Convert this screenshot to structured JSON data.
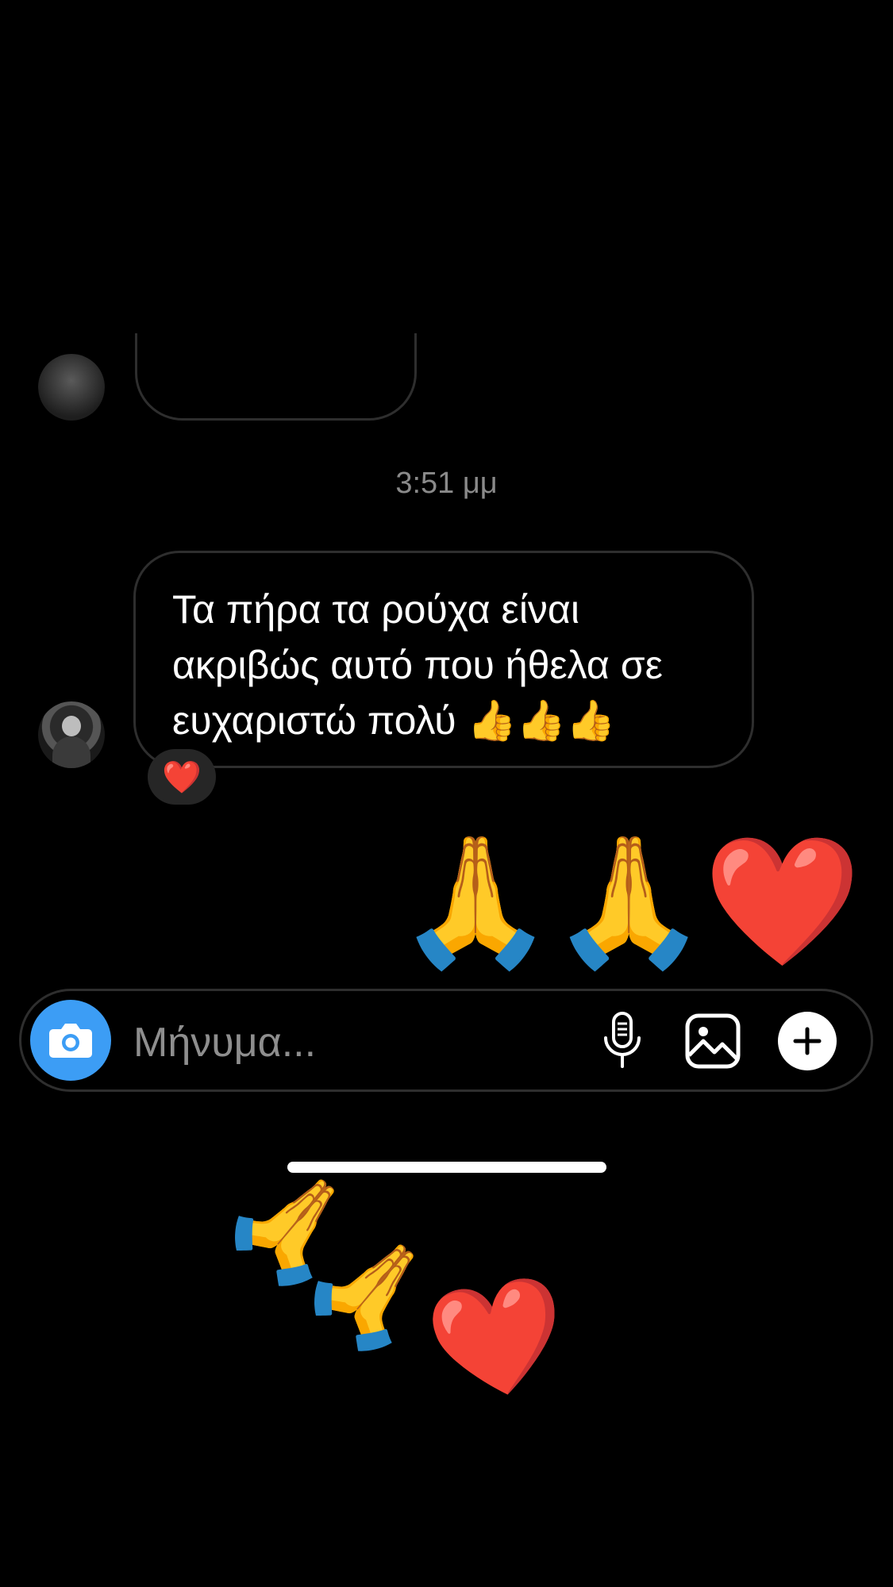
{
  "conversation": {
    "timestamp": "3:51 μμ",
    "incoming_message": {
      "text": "Τα πήρα τα ρούχα είναι ακριβώς αυτό που ήθελα σε ευχαριστώ πολύ 👍👍👍",
      "reaction": "❤️"
    },
    "outgoing_message": {
      "text": "🙏🙏❤️"
    }
  },
  "composer": {
    "placeholder": "Μήνυμα...",
    "camera_icon": "camera-icon",
    "mic_icon": "microphone-icon",
    "gallery_icon": "gallery-icon",
    "plus_icon": "plus-icon",
    "camera_color": "#3c9df5"
  },
  "overlay_stickers": {
    "first": "🙏",
    "second": "🙏",
    "third": "❤️"
  }
}
